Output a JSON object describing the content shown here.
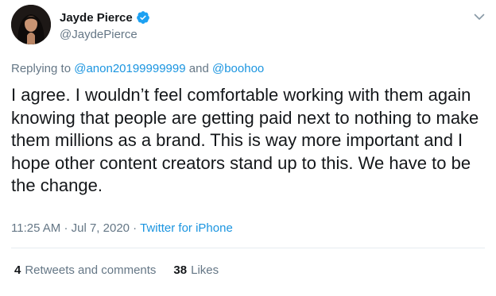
{
  "user": {
    "display_name": "Jayde Pierce",
    "handle": "@JaydePierce",
    "verified": true
  },
  "reply": {
    "prefix": "Replying to",
    "mention_1": "@anon20199999999",
    "joiner": "and",
    "mention_2": "@boohoo"
  },
  "tweet": {
    "text": "I agree. I wouldn’t feel comfortable working with them again knowing that people are getting paid next to nothing to make them millions as a brand. This is way more important and I hope other content creators stand up to this. We have to be the change."
  },
  "meta": {
    "time": "11:25 AM",
    "separator_1": "·",
    "date": "Jul 7, 2020",
    "separator_2": "·",
    "source": "Twitter for iPhone"
  },
  "stats": {
    "retweets_count": "4",
    "retweets_label": "Retweets and comments",
    "likes_count": "38",
    "likes_label": "Likes"
  },
  "icons": {
    "verified": "verified-badge-icon",
    "caret": "chevron-down-icon"
  },
  "colors": {
    "link": "#1b95e0",
    "secondary_text": "#657786",
    "primary_text": "#14171a",
    "verified_blue": "#1da1f2"
  }
}
